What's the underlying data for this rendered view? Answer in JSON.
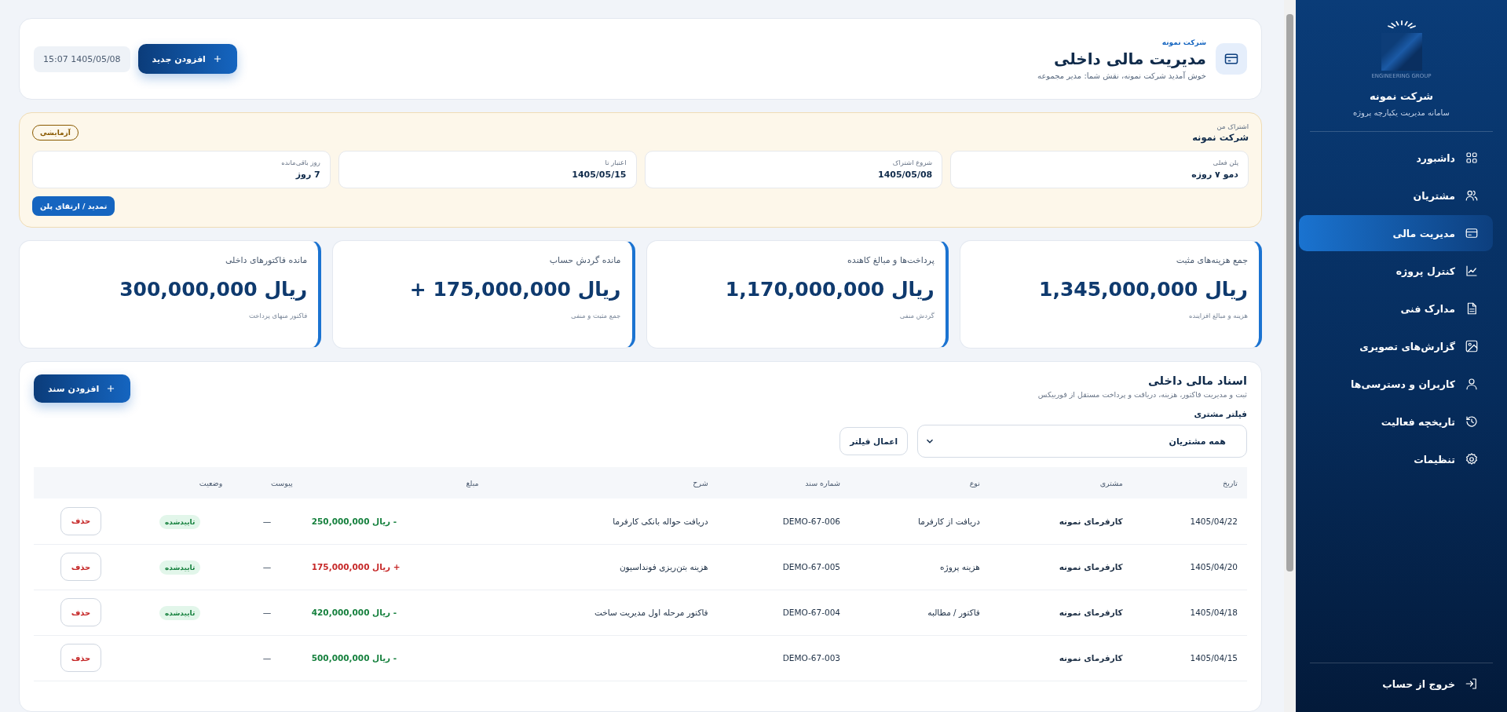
{
  "sidebar": {
    "logo_caption": "ENGINEERING GROUP",
    "company": "شرکت نمونه",
    "subtitle": "سامانه مدیریت یکپارچه پروژه",
    "items": [
      {
        "label": "داشبورد",
        "selected": false
      },
      {
        "label": "مشتریان",
        "selected": false
      },
      {
        "label": "مدیریت مالی",
        "selected": true
      },
      {
        "label": "کنترل پروژه",
        "selected": false
      },
      {
        "label": "مدارک فنی",
        "selected": false
      },
      {
        "label": "گزارش‌های تصویری",
        "selected": false
      },
      {
        "label": "کاربران و دسترسی‌ها",
        "selected": false
      },
      {
        "label": "تاریخچه فعالیت",
        "selected": false
      },
      {
        "label": "تنظیمات",
        "selected": false
      }
    ],
    "logout": "خروج از حساب"
  },
  "header": {
    "company": "شرکت نمونه",
    "title": "مدیریت مالی داخلی",
    "welcome": "خوش آمدید شرکت نمونه، نقش شما: مدیر مجموعه",
    "add_button": "افزودن جدید",
    "datetime": "15:07 1405/05/08"
  },
  "subscription": {
    "label": "اشتراک من",
    "company": "شرکت نمونه",
    "badge": "آزمایشی",
    "fields": [
      {
        "label": "پلن فعلی",
        "value": "دمو ۷ روزه"
      },
      {
        "label": "شروع اشتراک",
        "value": "1405/05/08"
      },
      {
        "label": "اعتبار تا",
        "value": "1405/05/15"
      },
      {
        "label": "روز باقی‌مانده",
        "value": "7 روز"
      }
    ],
    "renew_button": "تمدید / ارتقای پلن"
  },
  "stats": [
    {
      "title": "جمع هزینه‌های مثبت",
      "value": "1,345,000,000 ریال",
      "caption": "هزینه و مبالغ افزاینده"
    },
    {
      "title": "پرداخت‌ها و مبالغ کاهنده",
      "value": "1,170,000,000 ریال",
      "caption": "گردش منفی"
    },
    {
      "title": "مانده گردش حساب",
      "value": "+ 175,000,000 ریال",
      "caption": "جمع مثبت و منفی"
    },
    {
      "title": "مانده فاکتورهای داخلی",
      "value": "300,000,000 ریال",
      "caption": "فاکتور منهای پرداخت"
    }
  ],
  "documents": {
    "title": "اسناد مالی داخلی",
    "subtitle": "ثبت و مدیریت فاکتور، هزینه، دریافت و پرداخت مستقل از فوربیکس",
    "add_button": "افزودن سند",
    "filter": {
      "label": "فیلتر مشتری",
      "value": "همه مشتریان",
      "apply_button": "اعمال فیلتر"
    },
    "table": {
      "columns": [
        "تاریخ",
        "مشتری",
        "نوع",
        "شماره سند",
        "شرح",
        "مبلغ",
        "پیوست",
        "وضعیت"
      ],
      "rows": [
        {
          "date": "1405/04/22",
          "customer": "کارفرمای نمونه",
          "type": "دریافت از کارفرما",
          "number": "DEMO-67-006",
          "description": "دریافت حواله بانکی کارفرما",
          "amount": "ریال 250,000,000 -",
          "kind": "decrease",
          "attachment": "—",
          "status": "تاییدشده",
          "action": "حذف"
        },
        {
          "date": "1405/04/20",
          "customer": "کارفرمای نمونه",
          "type": "هزینه پروژه",
          "number": "DEMO-67-005",
          "description": "هزینه بتن‌ریزی فونداسیون",
          "amount": "ریال 175,000,000 +",
          "kind": "increase",
          "attachment": "—",
          "status": "تاییدشده",
          "action": "حذف"
        },
        {
          "date": "1405/04/18",
          "customer": "کارفرمای نمونه",
          "type": "فاکتور / مطالبه",
          "number": "DEMO-67-004",
          "description": "فاکتور مرحله اول مدیریت ساخت",
          "amount": "ریال 420,000,000 -",
          "kind": "decrease",
          "attachment": "—",
          "status": "تاییدشده",
          "action": "حذف"
        },
        {
          "date": "1405/04/15",
          "customer": "کارفرمای نمونه",
          "number": "DEMO-67-003",
          "amount": "ریال 500,000,000 -",
          "kind": "decrease",
          "attachment": "—",
          "action": "حذف"
        }
      ]
    }
  }
}
